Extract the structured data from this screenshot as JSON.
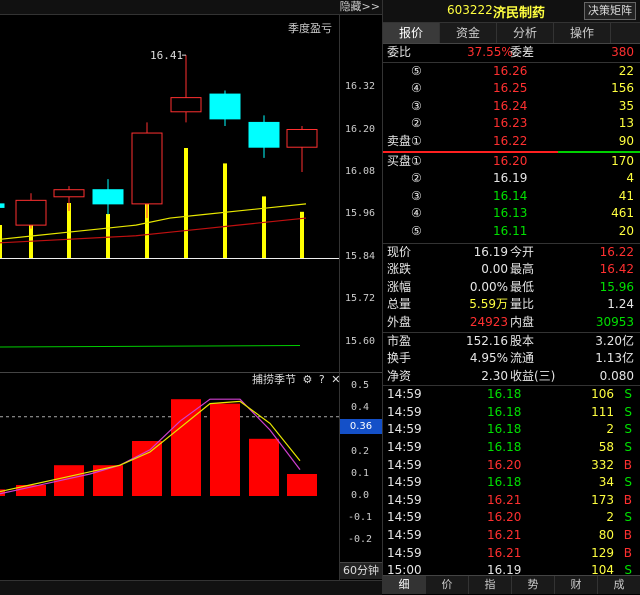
{
  "top_bar": {
    "hide_label": "隐藏>>"
  },
  "main_chart": {
    "title": "季度盈亏",
    "max_label": "16.41",
    "y_ticks": [
      "16.32",
      "16.20",
      "16.08",
      "15.96",
      "15.84",
      "15.72",
      "15.60"
    ]
  },
  "sub_chart": {
    "title": "捕捞季节",
    "gear_icon": "gear-icon",
    "help_icon": "help-icon",
    "close_icon": "close-icon",
    "y_ticks": [
      "0.5",
      "0.4",
      "0.3",
      "0.2",
      "0.1",
      "0.0",
      "-0.1",
      "-0.2"
    ],
    "current_value": "0.36",
    "period_label": "60分钟"
  },
  "chart_data": {
    "type": "bar",
    "candles": [
      {
        "open": 15.98,
        "close": 15.99,
        "high": 15.99,
        "low": 15.98,
        "up": false
      },
      {
        "open": 16.0,
        "close": 15.93,
        "high": 16.02,
        "low": 15.92,
        "up": true
      },
      {
        "open": 16.01,
        "close": 16.03,
        "high": 16.04,
        "low": 15.97,
        "up": true
      },
      {
        "open": 16.03,
        "close": 15.99,
        "high": 16.06,
        "low": 15.96,
        "up": false
      },
      {
        "open": 15.99,
        "close": 16.19,
        "high": 16.22,
        "low": 15.95,
        "up": true
      },
      {
        "open": 16.25,
        "close": 16.29,
        "high": 16.41,
        "low": 16.22,
        "up": true
      },
      {
        "open": 16.3,
        "close": 16.23,
        "high": 16.31,
        "low": 16.21,
        "up": false
      },
      {
        "open": 16.22,
        "close": 16.15,
        "high": 16.24,
        "low": 16.12,
        "up": false
      },
      {
        "open": 16.15,
        "close": 16.2,
        "high": 16.21,
        "low": 16.08,
        "up": true
      }
    ],
    "volume_bars": [
      0,
      0.3,
      0.52,
      0.5,
      0.4,
      0.73,
      1.0,
      0.86,
      0.56,
      0.42
    ],
    "ma_yellow": [
      15.89,
      15.9,
      15.91,
      15.92,
      15.93,
      15.95,
      15.96,
      15.97,
      15.98,
      15.99
    ],
    "ma_red": [
      15.88,
      15.885,
      15.89,
      15.895,
      15.9,
      15.91,
      15.92,
      15.93,
      15.94,
      15.95
    ],
    "osc_bars": [
      0.03,
      0.05,
      0.12,
      0.14,
      0.14,
      0.23,
      0.35,
      0.44,
      0.44,
      0.25,
      0.05
    ],
    "osc_line_yellow": [
      0.02,
      0.05,
      0.08,
      0.11,
      0.14,
      0.2,
      0.31,
      0.42,
      0.43,
      0.33,
      0.16
    ],
    "osc_line_purple": [
      0.01,
      0.04,
      0.07,
      0.1,
      0.14,
      0.21,
      0.34,
      0.44,
      0.44,
      0.3,
      0.12
    ]
  },
  "header": {
    "code": "603222",
    "name": "济民制药",
    "button": "决策矩阵"
  },
  "tabs": [
    "报价",
    "资金",
    "分析",
    "操作"
  ],
  "commission": {
    "label1": "委比",
    "ratio": "37.55%",
    "label2": "委差",
    "diff": "380"
  },
  "asks": [
    {
      "label": "⑤",
      "price": "16.26",
      "vol": "22"
    },
    {
      "label": "④",
      "price": "16.25",
      "vol": "156"
    },
    {
      "label": "③",
      "price": "16.24",
      "vol": "35"
    },
    {
      "label": "②",
      "price": "16.23",
      "vol": "13"
    },
    {
      "label": "卖盘①",
      "price": "16.22",
      "vol": "90"
    }
  ],
  "bids": [
    {
      "label": "买盘①",
      "price": "16.20",
      "vol": "170",
      "color": "red"
    },
    {
      "label": "②",
      "price": "16.19",
      "vol": "4",
      "color": "white"
    },
    {
      "label": "③",
      "price": "16.14",
      "vol": "41",
      "color": "green"
    },
    {
      "label": "④",
      "price": "16.13",
      "vol": "461",
      "color": "green"
    },
    {
      "label": "⑤",
      "price": "16.11",
      "vol": "20",
      "color": "green"
    }
  ],
  "stats": [
    {
      "l1": "现价",
      "v1": "16.19",
      "c1": "white",
      "l2": "今开",
      "v2": "16.22",
      "c2": "red"
    },
    {
      "l1": "涨跌",
      "v1": "0.00",
      "c1": "white",
      "l2": "最高",
      "v2": "16.42",
      "c2": "red"
    },
    {
      "l1": "涨幅",
      "v1": "0.00%",
      "c1": "white",
      "l2": "最低",
      "v2": "15.96",
      "c2": "green"
    },
    {
      "l1": "总量",
      "v1": "5.59万",
      "c1": "yellow",
      "l2": "量比",
      "v2": "1.24",
      "c2": "white"
    },
    {
      "l1": "外盘",
      "v1": "24923",
      "c1": "red",
      "l2": "内盘",
      "v2": "30953",
      "c2": "green"
    }
  ],
  "fundamentals": [
    {
      "l1": "市盈",
      "v1": "152.16",
      "l2": "股本",
      "v2": "3.20亿"
    },
    {
      "l1": "换手",
      "v1": "4.95%",
      "l2": "流通",
      "v2": "1.13亿"
    },
    {
      "l1": "净资",
      "v1": "2.30",
      "l2": "收益(三)",
      "v2": "0.080"
    }
  ],
  "ticks": [
    {
      "time": "14:59",
      "price": "16.18",
      "pc": "green",
      "vol": "106",
      "side": "S",
      "sc": "green"
    },
    {
      "time": "14:59",
      "price": "16.18",
      "pc": "green",
      "vol": "111",
      "side": "S",
      "sc": "green"
    },
    {
      "time": "14:59",
      "price": "16.18",
      "pc": "green",
      "vol": "2",
      "side": "S",
      "sc": "green"
    },
    {
      "time": "14:59",
      "price": "16.18",
      "pc": "green",
      "vol": "58",
      "side": "S",
      "sc": "green"
    },
    {
      "time": "14:59",
      "price": "16.20",
      "pc": "red",
      "vol": "332",
      "side": "B",
      "sc": "red"
    },
    {
      "time": "14:59",
      "price": "16.18",
      "pc": "green",
      "vol": "34",
      "side": "S",
      "sc": "green"
    },
    {
      "time": "14:59",
      "price": "16.21",
      "pc": "red",
      "vol": "173",
      "side": "B",
      "sc": "red"
    },
    {
      "time": "14:59",
      "price": "16.20",
      "pc": "red",
      "vol": "2",
      "side": "S",
      "sc": "green"
    },
    {
      "time": "14:59",
      "price": "16.21",
      "pc": "red",
      "vol": "80",
      "side": "B",
      "sc": "red"
    },
    {
      "time": "14:59",
      "price": "16.21",
      "pc": "red",
      "vol": "129",
      "side": "B",
      "sc": "red"
    },
    {
      "time": "15:00",
      "price": "16.19",
      "pc": "white",
      "vol": "104",
      "side": "S",
      "sc": "green"
    }
  ],
  "bottom_tabs": [
    "细",
    "价",
    "指",
    "势",
    "财",
    "成"
  ]
}
